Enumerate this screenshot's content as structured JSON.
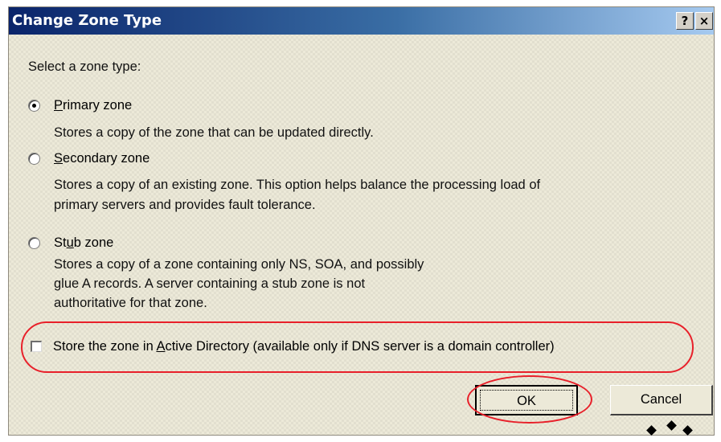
{
  "window": {
    "title": "Change Zone Type",
    "help_glyph": "?",
    "close_glyph": "×"
  },
  "prompt": "Select a zone type:",
  "options": [
    {
      "label_pre": "",
      "label_accel": "P",
      "label_post": "rimary zone",
      "checked": true,
      "description": [
        "Stores a copy of the zone that can be updated directly."
      ]
    },
    {
      "label_pre": "",
      "label_accel": "S",
      "label_post": "econdary zone",
      "checked": false,
      "description": [
        "Stores a copy of an existing zone. This option helps balance the processing load of",
        "primary servers and provides fault tolerance."
      ]
    },
    {
      "label_pre": "St",
      "label_accel": "u",
      "label_post": "b zone",
      "checked": false,
      "description": [
        "Stores a copy of a zone containing only NS, SOA, and possibly",
        "glue A records. A server containing a stub zone is not",
        "authoritative for that zone."
      ]
    }
  ],
  "active_directory": {
    "label_pre": "Store the zone in ",
    "label_accel": "A",
    "label_post": "ctive Directory (available only if DNS server is a domain controller)",
    "checked": false
  },
  "buttons": {
    "ok": "OK",
    "cancel": "Cancel"
  },
  "colors": {
    "highlight": "#e8202a",
    "titlebar_start": "#0a246a",
    "titlebar_end": "#a6caf0"
  }
}
